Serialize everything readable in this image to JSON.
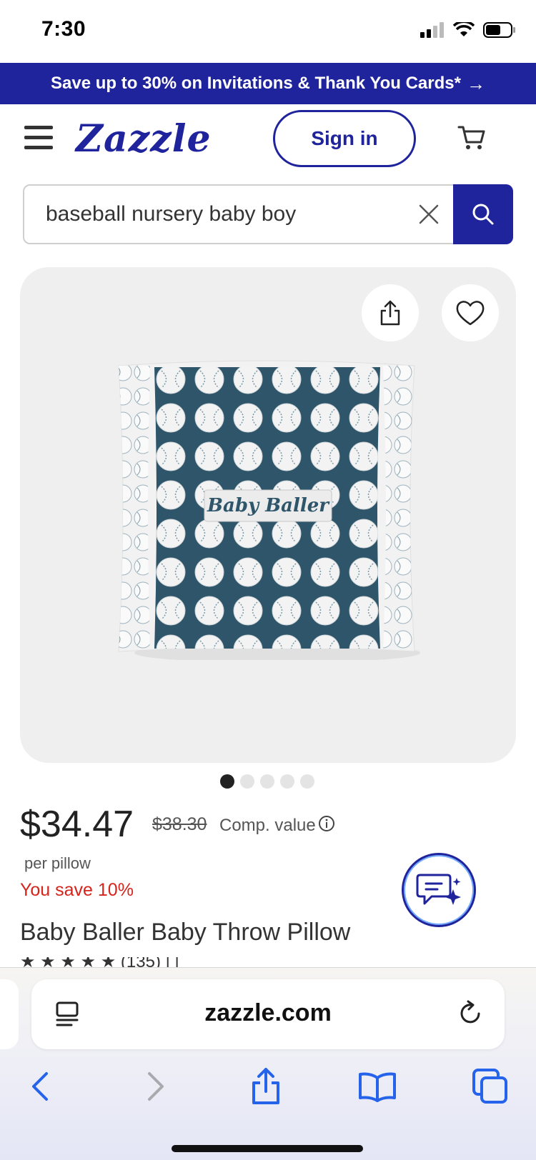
{
  "status_bar": {
    "time": "7:30"
  },
  "promo": {
    "text": "Save up to 30% on Invitations & Thank You Cards*",
    "arrow": "→"
  },
  "header": {
    "logo": "Zazzle",
    "sign_in": "Sign in"
  },
  "search": {
    "value": "baseball nursery baby boy"
  },
  "product": {
    "image_text": "Baby Baller",
    "price": "$34.47",
    "old_price": "$38.30",
    "comp_value": "Comp. value",
    "per_unit": "per pillow",
    "savings": "You save 10%",
    "title": "Baby Baller Baby Throw Pillow",
    "rating_partial": "★ ★ ★ ★ ★ (135) | |",
    "image_dots": 5,
    "active_dot": 1
  },
  "browser": {
    "url": "zazzle.com"
  },
  "colors": {
    "brand": "#1f239c",
    "savings": "#d4241c",
    "pillow": "#2e5569"
  }
}
